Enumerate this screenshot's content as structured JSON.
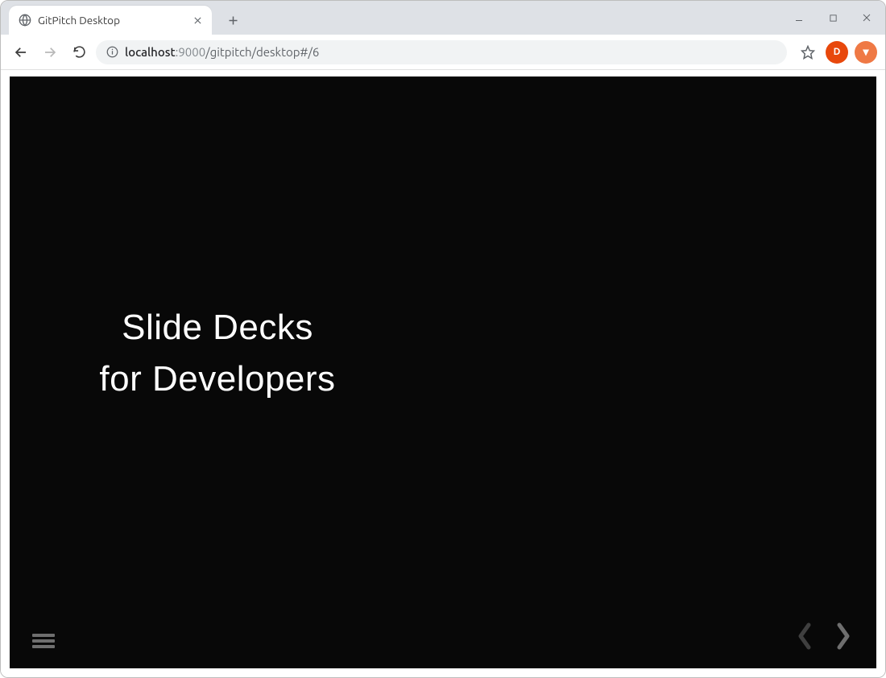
{
  "window": {
    "minimize_tooltip": "Minimize",
    "maximize_tooltip": "Maximize",
    "close_tooltip": "Close"
  },
  "tab": {
    "title": "GitPitch Desktop",
    "close_tooltip": "Close tab",
    "newtab_tooltip": "New tab"
  },
  "toolbar": {
    "back_tooltip": "Back",
    "forward_tooltip": "Forward",
    "reload_tooltip": "Reload",
    "info_tooltip": "View site information",
    "url_host_dark": "localhost",
    "url_host_light": ":9000",
    "url_path": "/gitpitch/desktop#/6",
    "star_tooltip": "Bookmark this page",
    "avatar_letter": "D"
  },
  "slide": {
    "title_line1": "Slide Decks",
    "title_line2": "for Developers",
    "menu_tooltip": "Slide menu",
    "prev_tooltip": "Previous slide",
    "next_tooltip": "Next slide"
  }
}
